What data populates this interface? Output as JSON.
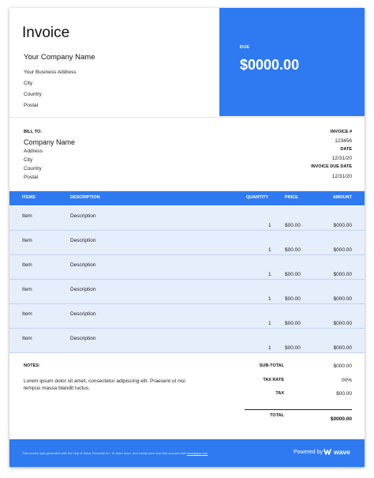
{
  "header": {
    "title": "Invoice",
    "company_name": "Your Company Name",
    "address_lines": [
      "Your Business Address",
      "City",
      "Country",
      "Postal"
    ],
    "due_label": "DUE",
    "due_amount": "$0000.00"
  },
  "bill_to": {
    "label": "BILL TO:",
    "company": "Company Name",
    "lines": [
      "Address",
      "City",
      "Country",
      "Postal"
    ]
  },
  "meta": {
    "invoice_label": "INVOICE #",
    "invoice_number": "123456",
    "date_label": "DATE",
    "date": "12/31/20",
    "due_date_label": "INVOICE DUE DATE",
    "due_date": "12/31/20"
  },
  "table": {
    "headers": [
      "ITEMS",
      "DESCRIPTION",
      "QUANTITY",
      "PRICE",
      "AMOUNT"
    ],
    "rows": [
      {
        "item": "Item",
        "description": "Description",
        "quantity": "1",
        "price": "$00.00",
        "amount": "$000.00"
      },
      {
        "item": "Item",
        "description": "Description",
        "quantity": "1",
        "price": "$00.00",
        "amount": "$000.00"
      },
      {
        "item": "Item",
        "description": "Description",
        "quantity": "1",
        "price": "$00.00",
        "amount": "$000.00"
      },
      {
        "item": "Item",
        "description": "Description",
        "quantity": "1",
        "price": "$00.00",
        "amount": "$000.00"
      },
      {
        "item": "Item",
        "description": "Description",
        "quantity": "1",
        "price": "$00.00",
        "amount": "$000.00"
      },
      {
        "item": "Item",
        "description": "Description",
        "quantity": "1",
        "price": "$00.00",
        "amount": "$000.00"
      }
    ]
  },
  "notes": {
    "label": "NOTES:",
    "text": "Lorem ipsum dolor sit amet, consectetur adipiscing elit. Praesent ut nisi tempus massa blandit luctus."
  },
  "totals": {
    "subtotal_label": "SUB-TOTAL",
    "subtotal": "$000.00",
    "tax_rate_label": "TAX RATE",
    "tax_rate": "00%",
    "tax_label": "TAX",
    "tax": "$00.00",
    "total_label": "TOTAL",
    "total": "$0000.00"
  },
  "footer": {
    "text": "This invoice was generated with the help of Wave Financial Inc. To learn more, and create your own free account visit",
    "link": "waveapps.com",
    "powered_by": "Powered by",
    "brand": "wave"
  },
  "colors": {
    "accent": "#2f7af0",
    "row_bg": "#e6edfb"
  },
  "icons": {
    "brand_logo": "wave-logo-icon"
  }
}
